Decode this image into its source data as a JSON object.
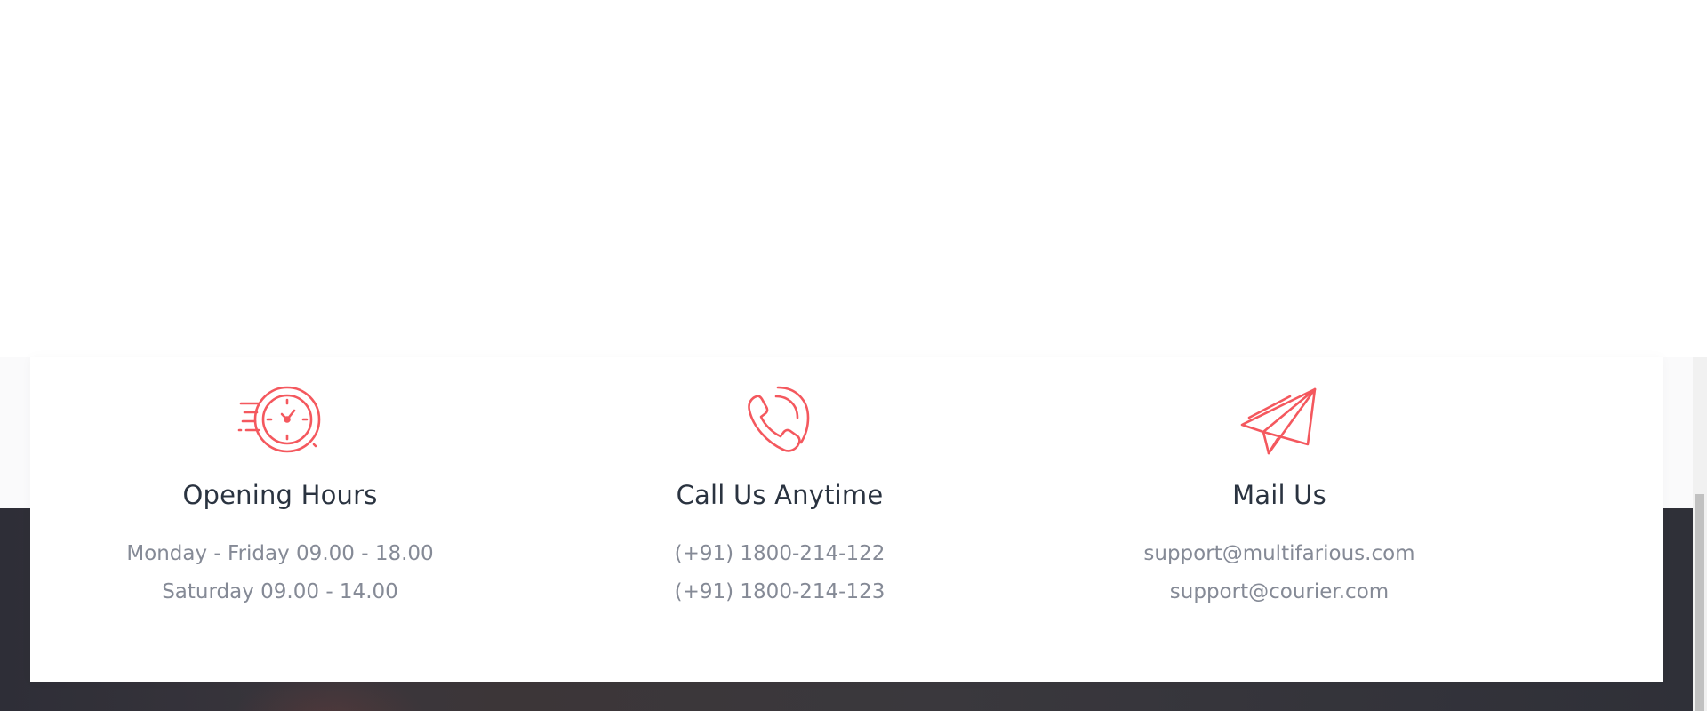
{
  "contact": {
    "accent_color": "#f4585e",
    "items": [
      {
        "icon": "clock-icon",
        "title": "Opening Hours",
        "lines": [
          "Monday - Friday 09.00 - 18.00",
          "Saturday 09.00 - 14.00"
        ]
      },
      {
        "icon": "phone-icon",
        "title": "Call Us Anytime",
        "lines": [
          "(+91) 1800-214-122",
          "(+91) 1800-214-123"
        ]
      },
      {
        "icon": "paper-plane-icon",
        "title": "Mail Us",
        "lines": [
          "support@multifarious.com",
          "support@courier.com"
        ]
      }
    ]
  }
}
